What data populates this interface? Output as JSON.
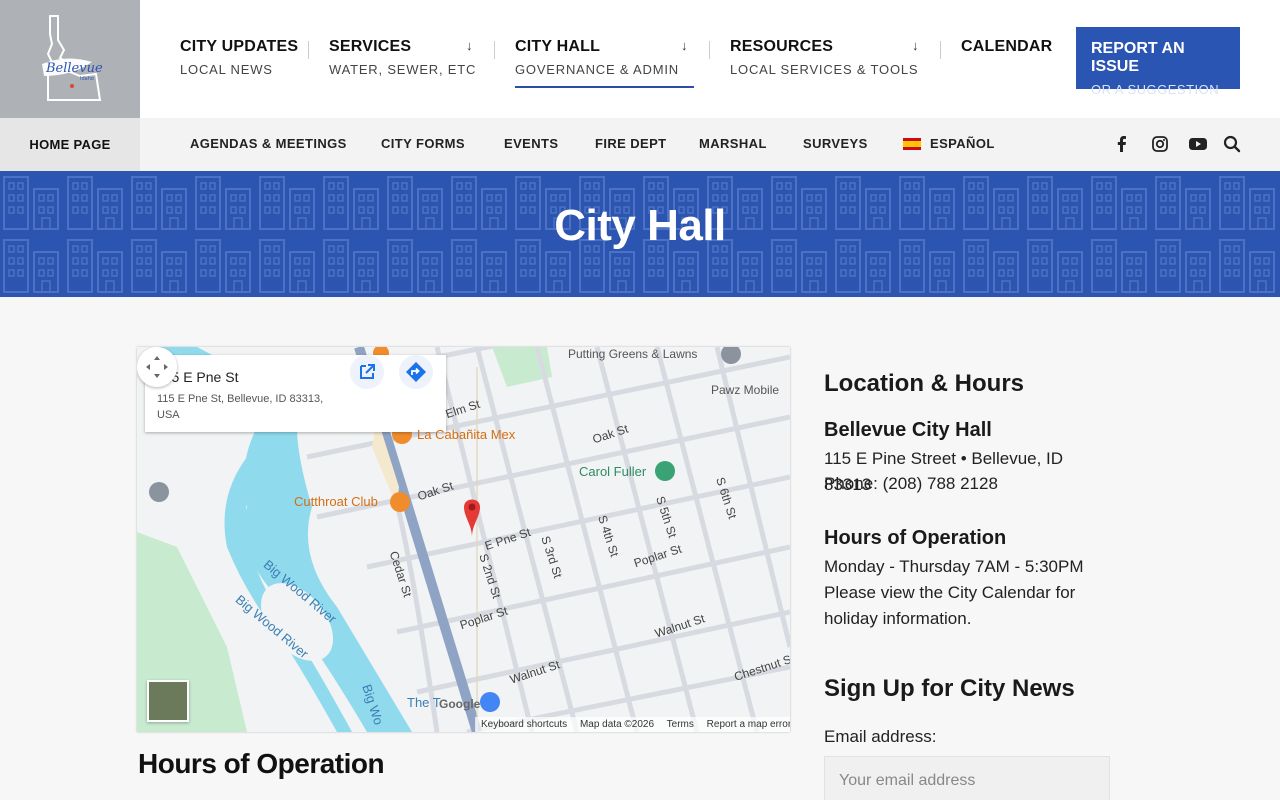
{
  "header": {
    "logo_text": "Bellevue",
    "logo_subtext": "Idaho",
    "nav": [
      {
        "label": "CITY UPDATES",
        "sub": "LOCAL NEWS"
      },
      {
        "label": "SERVICES",
        "sub": "WATER, SEWER, ETC"
      },
      {
        "label": "CITY HALL",
        "sub": "GOVERNANCE & ADMIN"
      },
      {
        "label": "RESOURCES",
        "sub": "LOCAL SERVICES & TOOLS"
      },
      {
        "label": "CALENDAR",
        "sub": ""
      }
    ],
    "dropdown_arrow": "↓",
    "report_button": {
      "label": "REPORT AN ISSUE",
      "sub": "OR A SUGGESTION"
    },
    "accent_color": "#2a55b2"
  },
  "subnav": {
    "home": "HOME PAGE",
    "links": [
      "AGENDAS & MEETINGS",
      "CITY FORMS",
      "EVENTS",
      "FIRE DEPT",
      "MARSHAL",
      "SURVEYS",
      "ESPAÑOL"
    ],
    "social_icons": [
      "facebook-icon",
      "instagram-icon",
      "youtube-icon",
      "search-icon"
    ]
  },
  "banner": {
    "title": "City Hall",
    "color": "#2b55b0"
  },
  "map": {
    "card_title": "115 E Pne St",
    "card_address": "115 E Pne St, Bellevue, ID 83313, USA",
    "labels": {
      "putting": "Putting Greens & Lawns",
      "pawz": "Pawz Mobile",
      "cabanita": "La Cabañita Mex",
      "carol": "Carol Fuller",
      "cutthroat": "Cutthroat Club",
      "elm": "Elm St",
      "oak1": "Oak St",
      "oak2": "Oak St",
      "pine": "E Pne St",
      "poplar1": "Poplar St",
      "poplar2": "Poplar St",
      "walnut1": "Walnut St",
      "walnut2": "Walnut St",
      "chestnut": "Chestnut S",
      "cedar": "Cedar St",
      "s2nd": "S 2nd St",
      "s3rd": "S 3rd St",
      "s4th": "S 4th St",
      "s5th": "S 5th St",
      "s6th": "S 6th St",
      "bigwood1": "Big Wood River",
      "bigwood2": "Big Wood River",
      "bigwood3": "Big Wo",
      "thetoo": "The T",
      "google": "Google"
    },
    "footer": [
      "Keyboard shortcuts",
      "Map data ©2026",
      "Terms",
      "Report a map error"
    ]
  },
  "main": {
    "hours_heading": "Hours of Operation"
  },
  "sidebar": {
    "location_heading": "Location & Hours",
    "office_name": "Bellevue City Hall",
    "address": "115 E Pine Street • Bellevue, ID 83313",
    "phone": "Phone: (208) 788 2128",
    "hours_heading": "Hours of Operation",
    "hours_line": "Monday - Thursday 7AM - 5:30PM",
    "hours_note": "Please view the City Calendar for holiday information.",
    "signup_heading": "Sign Up for City News",
    "email_label": "Email address:",
    "email_placeholder": "Your email address"
  }
}
